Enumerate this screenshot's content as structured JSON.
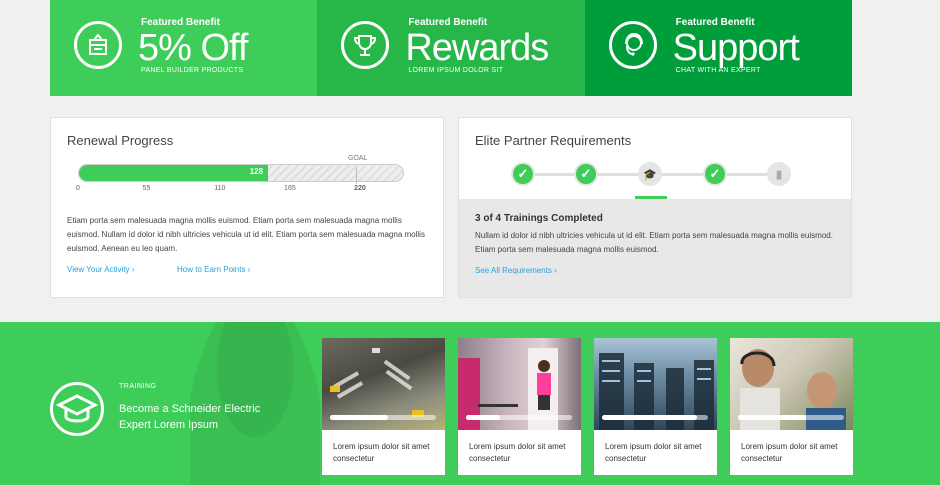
{
  "benefits": [
    {
      "kicker": "Featured Benefit",
      "title": "5% Off",
      "subtitle": "PANEL BUILDER PRODUCTS",
      "icon": "gift-tag-icon",
      "color": "#3dcd58"
    },
    {
      "kicker": "Featured Benefit",
      "title": "Rewards",
      "subtitle": "LOREM IPSUM DOLOR SIT",
      "icon": "trophy-icon",
      "color": "#27b748"
    },
    {
      "kicker": "Featured Benefit",
      "title": "Support",
      "subtitle": "CHAT WITH AN EXPERT",
      "icon": "headset-icon",
      "color": "#009e3a"
    }
  ],
  "renewal": {
    "title": "Renewal Progress",
    "goal_label": "GOAL",
    "current_value": "128",
    "progress_fraction": 0.582,
    "ticks": [
      "0",
      "55",
      "110",
      "165",
      "220"
    ],
    "description": "Etiam porta sem malesuada magna mollis euismod. Etiam porta sem malesuada magna mollis euismod. Nullam id dolor id nibh ultricies vehicula ut id elit. Etiam porta sem malesuada magna mollis euismod. Aenean eu leo quam.",
    "link_activity": "View Your Activity",
    "link_earn": "How to Earn Points"
  },
  "elite": {
    "title": "Elite Partner Requirements",
    "steps": [
      "done",
      "done",
      "current",
      "done",
      "pending"
    ],
    "status": "3 of 4 Trainings Completed",
    "description": "Nullam id dolor id nibh ultricies vehicula ut id elit. Etiam porta sem malesuada magna mollis euismod. Etiam porta sem malesuada magna mollis euismod.",
    "link": "See All Requirements"
  },
  "training": {
    "kicker": "TRAINING",
    "title": "Become a Schneider Electric Expert Lorem Ipsum",
    "tiles": [
      {
        "caption": "Lorem ipsum dolor sit amet consectetur",
        "progress": 0.55
      },
      {
        "caption": "Lorem ipsum dolor sit amet consectetur",
        "progress": 0.32
      },
      {
        "caption": "Lorem ipsum dolor sit amet consectetur",
        "progress": 0.9
      },
      {
        "caption": "Lorem ipsum dolor sit amet consectetur",
        "progress": 0.64
      }
    ]
  },
  "colors": {
    "brand_green": "#3dcd58",
    "link_blue": "#2b9fd9"
  }
}
